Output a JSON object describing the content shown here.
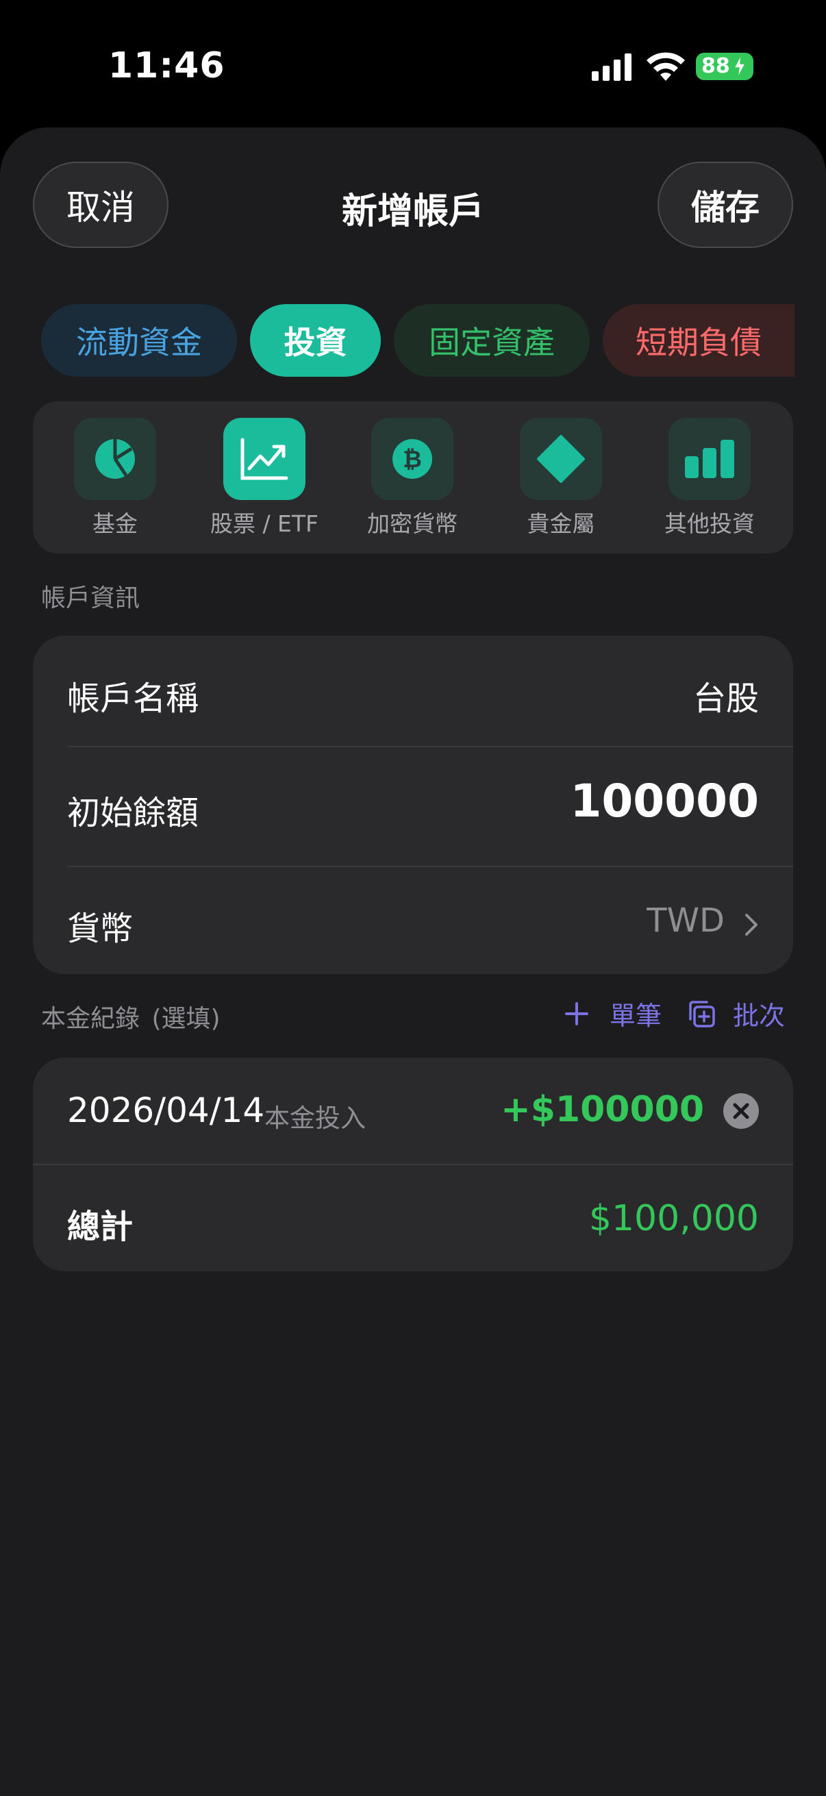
{
  "status_bar": {
    "time": "11:46",
    "battery": "88"
  },
  "header": {
    "cancel": "取消",
    "title": "新增帳戶",
    "save": "儲存"
  },
  "categories": [
    {
      "label": "流動資金",
      "color": "#4aa3e0"
    },
    {
      "label": "投資",
      "selected": true,
      "color": "#1abc9c"
    },
    {
      "label": "固定資產",
      "color": "#34c06a"
    },
    {
      "label": "短期負債",
      "color": "#ff6b6b"
    }
  ],
  "types": [
    {
      "label": "基金",
      "icon": "pie-chart-icon"
    },
    {
      "label": "股票 / ETF",
      "icon": "trend-up-icon",
      "selected": true
    },
    {
      "label": "加密貨幣",
      "icon": "bitcoin-icon"
    },
    {
      "label": "貴金屬",
      "icon": "diamond-icon"
    },
    {
      "label": "其他投資",
      "icon": "bar-chart-icon"
    }
  ],
  "account_info": {
    "section_label": "帳戶資訊",
    "name_label": "帳戶名稱",
    "name_value": "台股",
    "balance_label": "初始餘額",
    "balance_value": "100000",
    "currency_label": "貨幣",
    "currency_value": "TWD"
  },
  "principal": {
    "section_label": "本金紀錄",
    "optional": "(選填)",
    "single_label": "單筆",
    "batch_label": "批次",
    "records": [
      {
        "date": "2026/04/14",
        "type": "本金投入",
        "amount": "+$100000"
      }
    ],
    "total_label": "總計",
    "total_value": "$100,000"
  },
  "colors": {
    "accent": "#1abc9c",
    "positive": "#34c759",
    "link": "#7b73e6"
  }
}
